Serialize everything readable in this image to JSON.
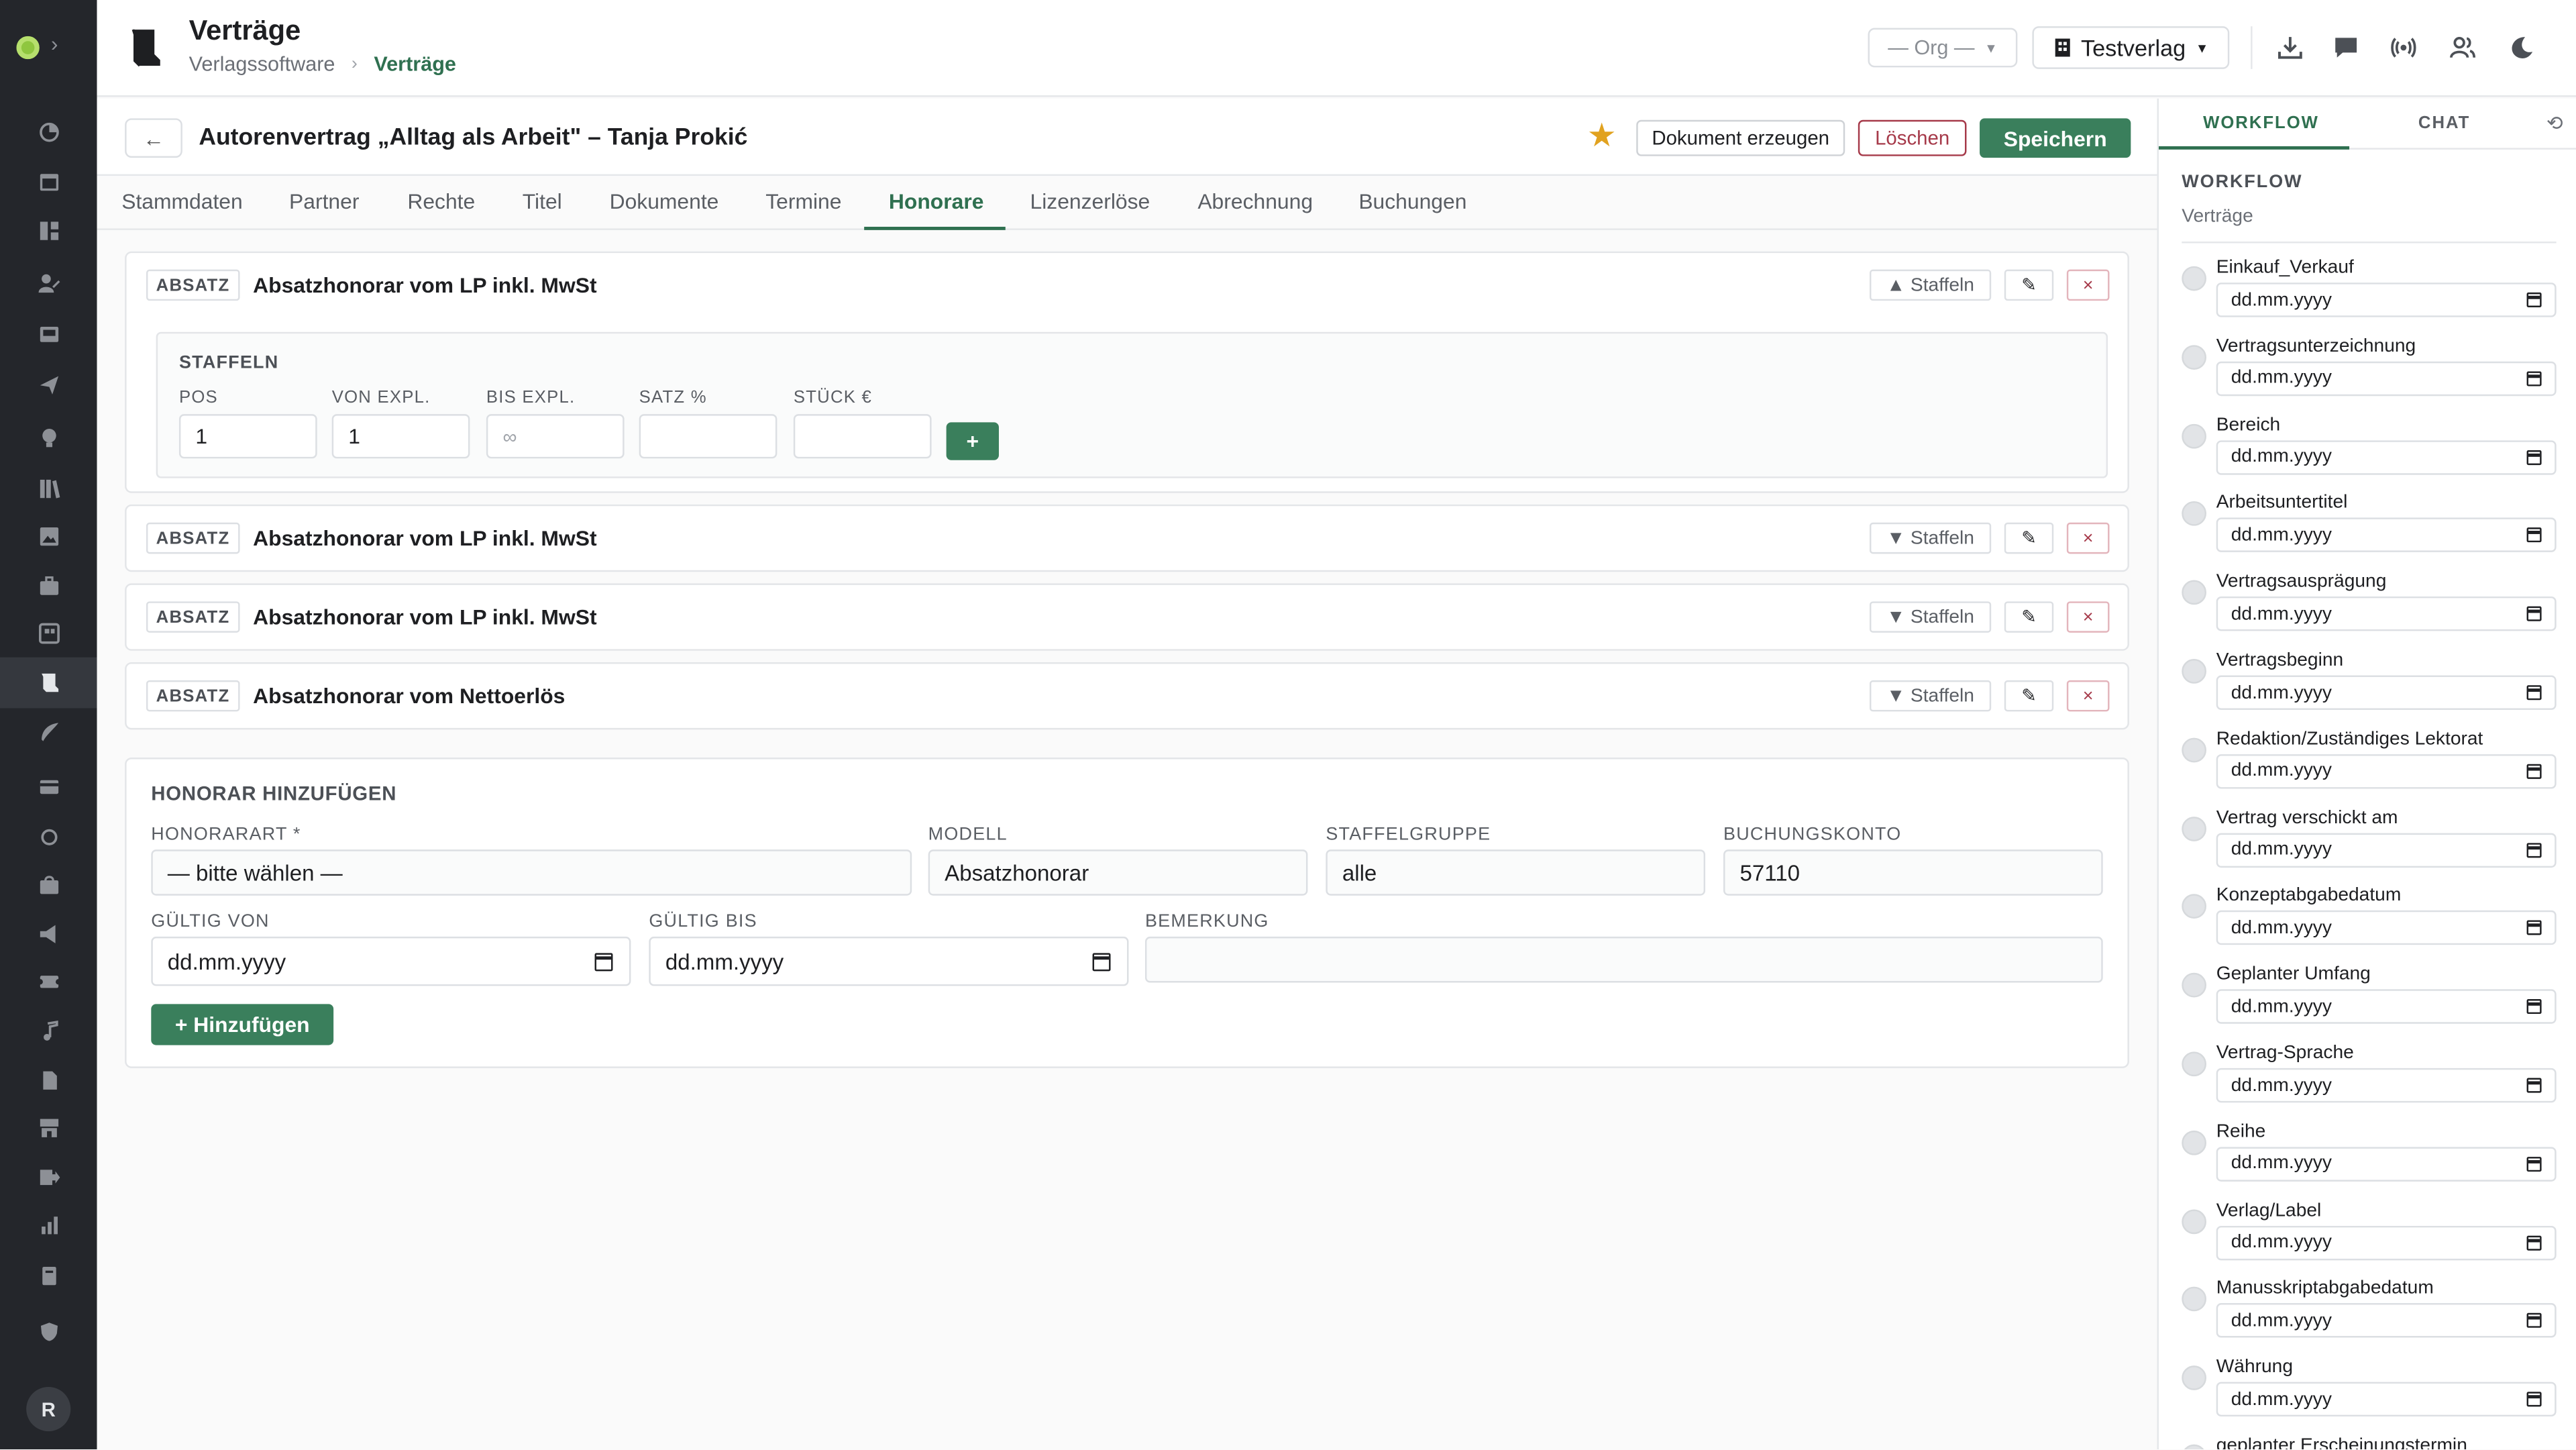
{
  "header": {
    "title": "Verträge",
    "breadcrumb": [
      "Verlagssoftware",
      "Verträge"
    ],
    "breadcrumb_sep": "›",
    "org_select": "— Org —",
    "verlag_select": "Testverlag"
  },
  "sidebar": {
    "chevron": "›",
    "avatar": "R",
    "icons": [
      "dashboard-icon",
      "calendar-icon",
      "grid-icon",
      "user-edit-icon",
      "inbox-icon",
      "send-icon",
      "lightbulb-icon",
      "library-icon",
      "image-icon",
      "briefcase-icon",
      "media-icon",
      "contract-icon",
      "feather-icon",
      "card-icon",
      "circle-icon",
      "bag-icon",
      "megaphone-icon",
      "ticket-icon",
      "music-icon",
      "file-icon",
      "shop-icon",
      "export-icon",
      "chart-icon",
      "book-icon",
      "shield-icon"
    ]
  },
  "document": {
    "back_label": "←",
    "title": "Autorenvertrag „Alltag als Arbeit\" – Tanja Prokić",
    "star": "★",
    "create_doc_label": "Dokument erzeugen",
    "delete_label": "Löschen",
    "save_label": "Speichern"
  },
  "tabs": [
    {
      "label": "Stammdaten"
    },
    {
      "label": "Partner"
    },
    {
      "label": "Rechte"
    },
    {
      "label": "Titel"
    },
    {
      "label": "Dokumente"
    },
    {
      "label": "Termine"
    },
    {
      "label": "Honorare",
      "active": true
    },
    {
      "label": "Lizenzerlöse"
    },
    {
      "label": "Abrechnung"
    },
    {
      "label": "Buchungen"
    }
  ],
  "honorare": [
    {
      "tag": "ABSATZ",
      "title": "Absatzhonorar vom LP inkl. MwSt",
      "staffeln_label": "▲ Staffeln",
      "expanded": true
    },
    {
      "tag": "ABSATZ",
      "title": "Absatzhonorar vom LP inkl. MwSt",
      "staffeln_label": "▼ Staffeln"
    },
    {
      "tag": "ABSATZ",
      "title": "Absatzhonorar vom LP inkl. MwSt",
      "staffeln_label": "▼ Staffeln"
    },
    {
      "tag": "ABSATZ",
      "title": "Absatzhonorar vom Nettoerlös",
      "staffeln_label": "▼ Staffeln"
    }
  ],
  "row_actions": {
    "edit": "✎",
    "delete": "×"
  },
  "staffeln": {
    "heading": "STAFFELN",
    "columns": [
      "POS",
      "VON EXPL.",
      "BIS EXPL.",
      "SATZ %",
      "STÜCK €"
    ],
    "values": [
      "1",
      "1",
      "",
      "",
      ""
    ],
    "placeholders": [
      "",
      "",
      "∞",
      "",
      ""
    ],
    "add_label": "+"
  },
  "add_form": {
    "heading": "HONORAR HINZUFÜGEN",
    "honorarart_label": "HONORARART *",
    "honorarart_value": "— bitte wählen —",
    "modell_label": "MODELL",
    "modell_value": "Absatzhonorar",
    "staffelgruppe_label": "STAFFELGRUPPE",
    "staffelgruppe_value": "alle",
    "buchungskonto_label": "BUCHUNGSKONTO",
    "buchungskonto_value": "57110",
    "gueltig_von_label": "GÜLTIG VON",
    "gueltig_von_value": "dd.mm.yyyy",
    "gueltig_bis_label": "GÜLTIG BIS",
    "gueltig_bis_value": "dd.mm.yyyy",
    "bemerkung_label": "BEMERKUNG",
    "bemerkung_value": "",
    "submit_label": "+ Hinzufügen"
  },
  "right_panel": {
    "tabs": [
      {
        "label": "WORKFLOW",
        "active": true
      },
      {
        "label": "CHAT"
      }
    ],
    "refresh": "⟲",
    "heading": "WORKFLOW",
    "subheading": "Verträge",
    "date_placeholder": "dd.mm.yyyy",
    "steps": [
      "Einkauf_Verkauf",
      "Vertragsunterzeichnung",
      "Bereich",
      "Arbeitsuntertitel",
      "Vertragsausprägung",
      "Vertragsbeginn",
      "Redaktion/Zuständiges Lektorat",
      "Vertrag verschickt am",
      "Konzeptabgabedatum",
      "Geplanter Umfang",
      "Vertrag-Sprache",
      "Reihe",
      "Verlag/Label",
      "Manusskriptabgabedatum",
      "Währung",
      "geplanter Erscheinungstermin"
    ]
  },
  "colors": {
    "accent": "#2f7050",
    "primary_button": "#3a7f5c",
    "danger": "#a63a4a",
    "star": "#e1a21f",
    "sidebar": "#24262b"
  }
}
